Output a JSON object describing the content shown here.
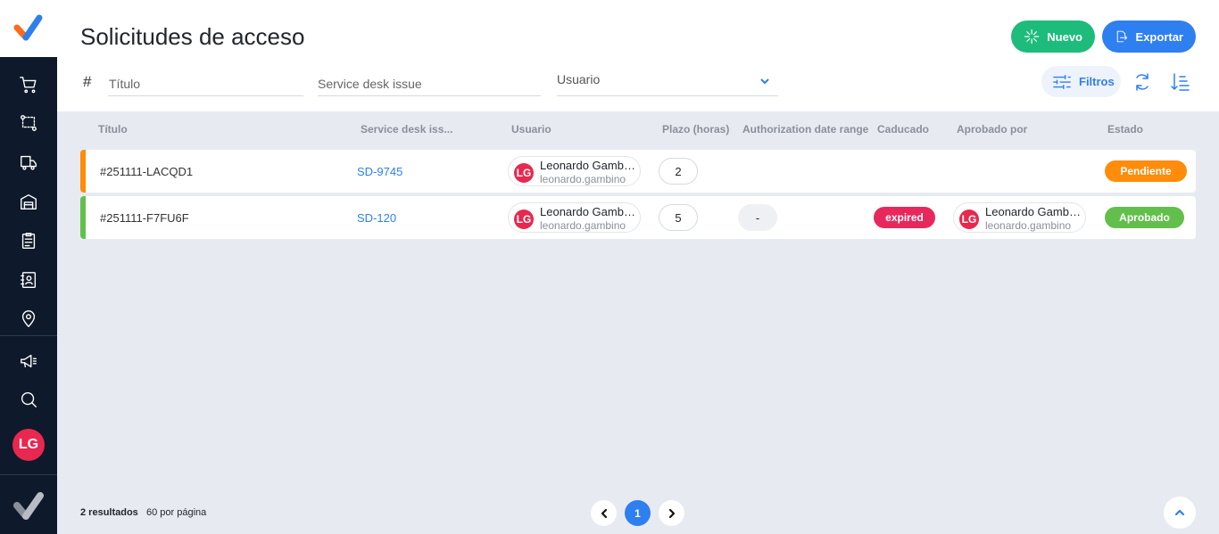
{
  "page": {
    "title": "Solicitudes de acceso"
  },
  "actions": {
    "new_label": "Nuevo",
    "export_label": "Exportar",
    "filters_label": "Filtros"
  },
  "filters": {
    "hash": "#",
    "title_placeholder": "Título",
    "sd_placeholder": "Service desk issue",
    "user_placeholder": "Usuario"
  },
  "table": {
    "headers": [
      "Título",
      "Service desk iss...",
      "Usuario",
      "Plazo (horas)",
      "Authorization date range",
      "Caducado",
      "Aprobado por",
      "Estado"
    ],
    "rows": [
      {
        "id": "#251111-LACQD1",
        "sd": "SD-9745",
        "user": {
          "initials": "LG",
          "name": "Leonardo Gambino",
          "email": "leonardo.gambino"
        },
        "plazo": "2",
        "status": "Pendiente",
        "status_color": "#ff8c0a"
      },
      {
        "id": "#251111-F7FU6F",
        "sd": "SD-120",
        "user": {
          "initials": "LG",
          "name": "Leonardo Gambino",
          "email": "leonardo.gambino"
        },
        "plazo": "5",
        "date_range": "-",
        "expired": "expired",
        "approver": {
          "initials": "LG",
          "name": "Leonardo Gambino",
          "email": "leonardo.gambino"
        },
        "status": "Aprobado",
        "status_color": "#62bf4b"
      }
    ]
  },
  "sidebar": {
    "user_initials": "LG"
  },
  "footer": {
    "results_count": "2 resultados",
    "per_page": "60 por página",
    "current_page": "1"
  },
  "colors": {
    "accent": "#2e7ff0",
    "success": "#1dbb7c",
    "sidebar": "#0e1a2b",
    "avatar": "#e8284f"
  },
  "icons": [
    "logo",
    "cart-icon",
    "flow-icon",
    "truck-icon",
    "warehouse-icon",
    "clipboard-icon",
    "contacts-icon",
    "location-icon",
    "megaphone-icon",
    "search-icon",
    "sparkle-icon",
    "export-icon",
    "filter-sliders-icon",
    "refresh-icon",
    "sort-icon",
    "chevron-down-icon",
    "chevron-left-icon",
    "chevron-right-icon",
    "chevron-up-icon"
  ]
}
